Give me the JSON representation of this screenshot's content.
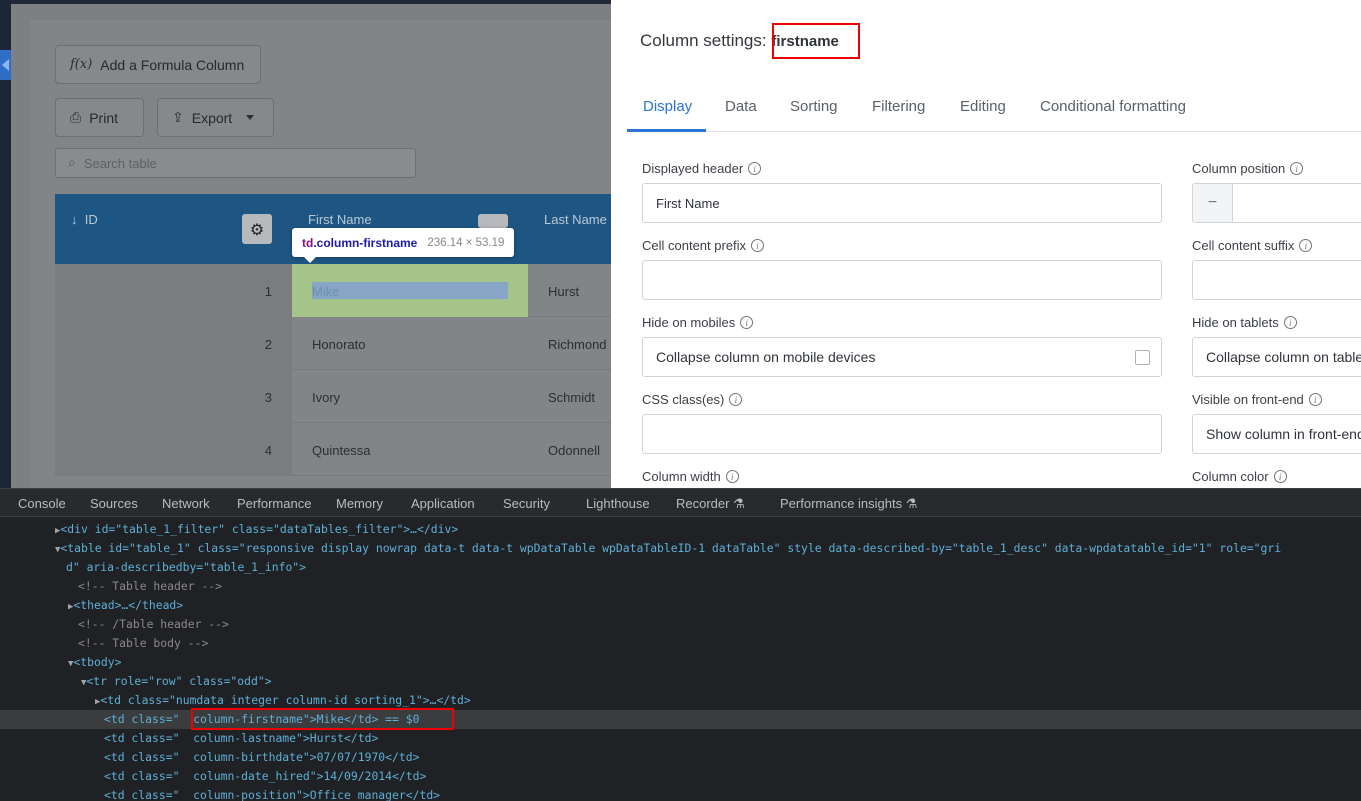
{
  "page": {
    "buttons": {
      "formula_icon": "f(x)",
      "formula_label": "Add a Formula Column",
      "print_label": "Print",
      "export_label": "Export"
    },
    "search": {
      "placeholder": "Search table"
    },
    "table": {
      "headers": {
        "id": "ID",
        "first": "First Name",
        "last": "Last Name"
      },
      "rows": [
        {
          "id": "1",
          "first": "Mike",
          "last": "Hurst"
        },
        {
          "id": "2",
          "first": "Honorato",
          "last": "Richmond"
        },
        {
          "id": "3",
          "first": "Ivory",
          "last": "Schmidt"
        },
        {
          "id": "4",
          "first": "Quintessa",
          "last": "Odonnell"
        }
      ]
    },
    "tooltip": {
      "tag": "td",
      "class": ".column-firstname",
      "dims": "236.14 × 53.19"
    }
  },
  "panel": {
    "title_prefix": "Column settings:",
    "column_name": "firstname",
    "tabs": [
      "Display",
      "Data",
      "Sorting",
      "Filtering",
      "Editing",
      "Conditional formatting"
    ],
    "active_tab": "Display",
    "fields": {
      "displayed_header": {
        "label": "Displayed header",
        "value": "First Name"
      },
      "column_position": {
        "label": "Column position",
        "minus": "−"
      },
      "prefix": {
        "label": "Cell content prefix",
        "value": ""
      },
      "suffix": {
        "label": "Cell content suffix",
        "value": ""
      },
      "hide_mobiles": {
        "label": "Hide on mobiles",
        "value": "Collapse column on mobile devices"
      },
      "hide_tablets": {
        "label": "Hide on tablets",
        "value": "Collapse column on tablets"
      },
      "css_class": {
        "label": "CSS class(es)",
        "value": ""
      },
      "visible_front": {
        "label": "Visible on front-end",
        "value": "Show column in front-end"
      },
      "column_width": {
        "label": "Column width"
      },
      "column_color": {
        "label": "Column color"
      }
    }
  },
  "devtools": {
    "tabs": [
      "Console",
      "Sources",
      "Network",
      "Performance",
      "Memory",
      "Application",
      "Security",
      "Lighthouse",
      "Recorder ⚗",
      "Performance insights ⚗"
    ],
    "lines": [
      "<div id=\"table_1_filter\" class=\"dataTables_filter\">…</div>",
      "<table id=\"table_1\" class=\"responsive display nowrap data-t data-t wpDataTable wpDataTableID-1 dataTable\" style data-described-by=\"table_1_desc\" data-wpdatatable_id=\"1\" role=\"gri",
      "d\" aria-describedby=\"table_1_info\">",
      "<!-- Table header -->",
      "<thead>…</thead>",
      "<!-- /Table header -->",
      "<!-- Table body -->",
      "<tbody>",
      "<tr role=\"row\" class=\"odd\">",
      "<td class=\"numdata integer column-id sorting_1\">…</td>",
      "<td class=\"  column-firstname\">Mike</td> == $0",
      "<td class=\"  column-lastname\">Hurst</td>",
      "<td class=\"  column-birthdate\">07/07/1970</td>",
      "<td class=\"  column-date_hired\">14/09/2014</td>",
      "<td class=\"  column-position\">Office manager</td>"
    ]
  }
}
